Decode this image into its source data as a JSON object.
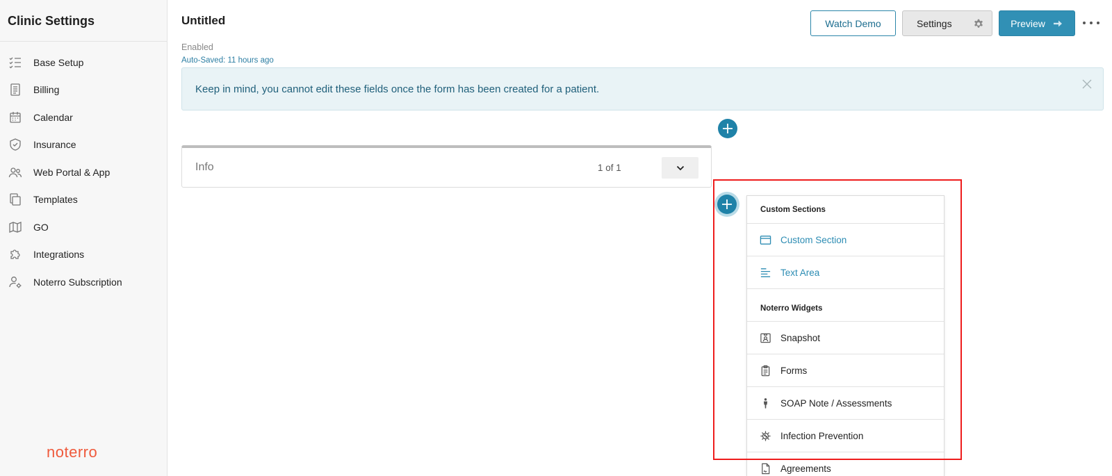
{
  "sidebar": {
    "title": "Clinic Settings",
    "items": [
      {
        "label": "Base Setup",
        "icon": "checklist-icon"
      },
      {
        "label": "Billing",
        "icon": "document-icon"
      },
      {
        "label": "Calendar",
        "icon": "calendar-icon"
      },
      {
        "label": "Insurance",
        "icon": "shield-icon"
      },
      {
        "label": "Web Portal & App",
        "icon": "users-icon"
      },
      {
        "label": "Templates",
        "icon": "copy-icon"
      },
      {
        "label": "GO",
        "icon": "map-icon"
      },
      {
        "label": "Integrations",
        "icon": "puzzle-icon"
      },
      {
        "label": "Noterro Subscription",
        "icon": "user-gear-icon"
      }
    ],
    "logo": "noterro"
  },
  "header": {
    "title": "Untitled",
    "status": "Enabled",
    "autosaved": "Auto-Saved: 11 hours ago",
    "watch_demo": "Watch Demo",
    "settings": "Settings",
    "preview": "Preview"
  },
  "alert": {
    "text": "Keep in mind, you cannot edit these fields once the form has been created for a patient."
  },
  "info_card": {
    "label": "Info",
    "count": "1 of 1"
  },
  "menu": {
    "section1": "Custom Sections",
    "custom_items": [
      {
        "label": "Custom Section",
        "icon": "window-icon"
      },
      {
        "label": "Text Area",
        "icon": "text-align-icon"
      }
    ],
    "section2": "Noterro Widgets",
    "widget_items": [
      {
        "label": "Snapshot",
        "icon": "id-card-icon"
      },
      {
        "label": "Forms",
        "icon": "clipboard-icon"
      },
      {
        "label": "SOAP Note / Assessments",
        "icon": "person-icon"
      },
      {
        "label": "Infection Prevention",
        "icon": "virus-icon"
      },
      {
        "label": "Agreements",
        "icon": "contract-icon"
      }
    ]
  },
  "colors": {
    "accent": "#1f82a8",
    "logo": "#ef5a3c",
    "highlight": "#ee1c1c",
    "alert_bg": "#e9f3f6"
  }
}
